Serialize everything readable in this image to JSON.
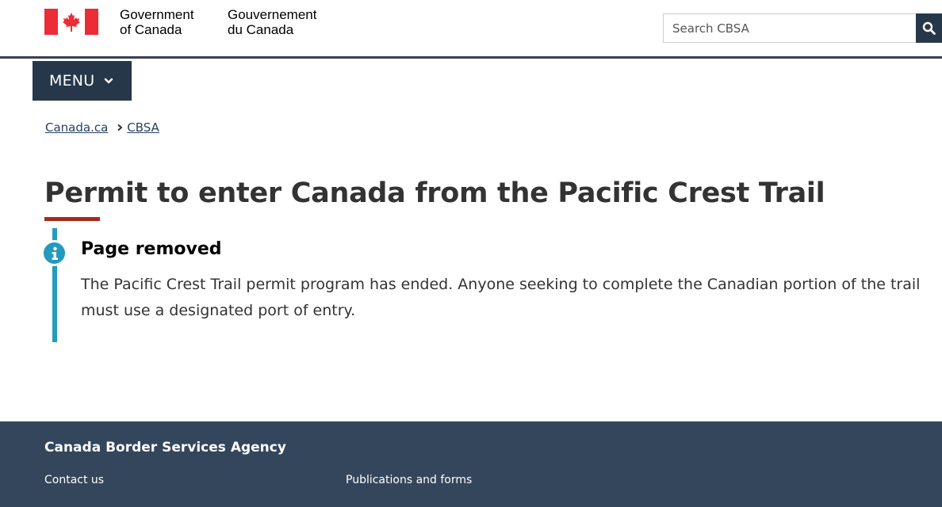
{
  "header": {
    "signature_en_line1": "Government",
    "signature_en_line2": "of Canada",
    "signature_fr_line1": "Gouvernement",
    "signature_fr_line2": "du Canada",
    "flag_color": "#eb2d37",
    "search": {
      "placeholder": "Search CBSA",
      "button_icon": "search-icon"
    }
  },
  "menu": {
    "label": "MENU",
    "icon": "chevron-down-icon"
  },
  "breadcrumb": {
    "items": [
      "Canada.ca",
      "CBSA"
    ]
  },
  "page": {
    "title": "Permit to enter Canada from the Pacific Crest Trail",
    "accent_color": "#a62a1e"
  },
  "alert": {
    "icon": "info-icon",
    "color": "#269abc",
    "title": "Page removed",
    "body": "The Pacific Crest Trail permit program has ended. Anyone seeking to complete the Canadian portion of the trail must use a designated port of entry."
  },
  "footer": {
    "title": "Canada Border Services Agency",
    "links": [
      "Contact us",
      "Publications and forms"
    ],
    "background": "#33465c"
  }
}
